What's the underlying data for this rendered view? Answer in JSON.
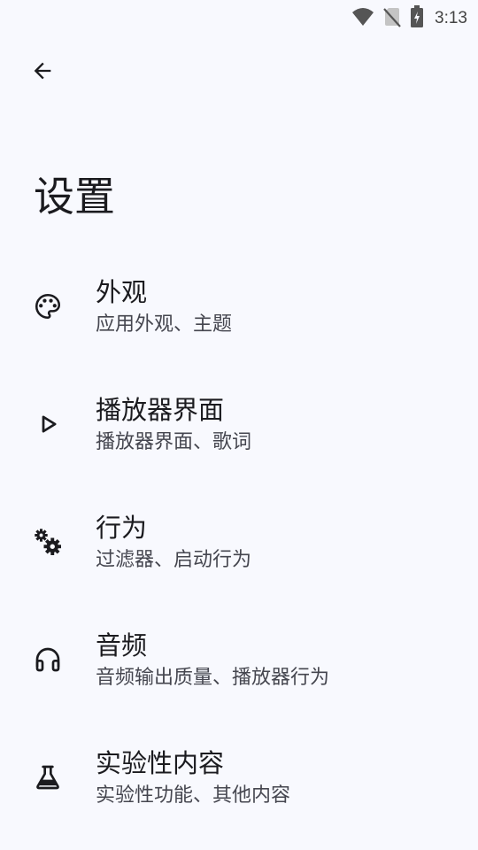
{
  "status_bar": {
    "time": "3:13",
    "icons": [
      "wifi-icon",
      "no-sim-icon",
      "battery-charging-icon"
    ]
  },
  "header": {
    "back_icon": "arrow-back-icon",
    "title": "设置"
  },
  "settings": {
    "items": [
      {
        "icon": "palette-icon",
        "title": "外观",
        "subtitle": "应用外观、主题"
      },
      {
        "icon": "play-icon",
        "title": "播放器界面",
        "subtitle": "播放器界面、歌词"
      },
      {
        "icon": "gears-icon",
        "title": "行为",
        "subtitle": "过滤器、启动行为"
      },
      {
        "icon": "headphones-icon",
        "title": "音频",
        "subtitle": "音频输出质量、播放器行为"
      },
      {
        "icon": "flask-icon",
        "title": "实验性内容",
        "subtitle": "实验性功能、其他内容"
      }
    ]
  }
}
